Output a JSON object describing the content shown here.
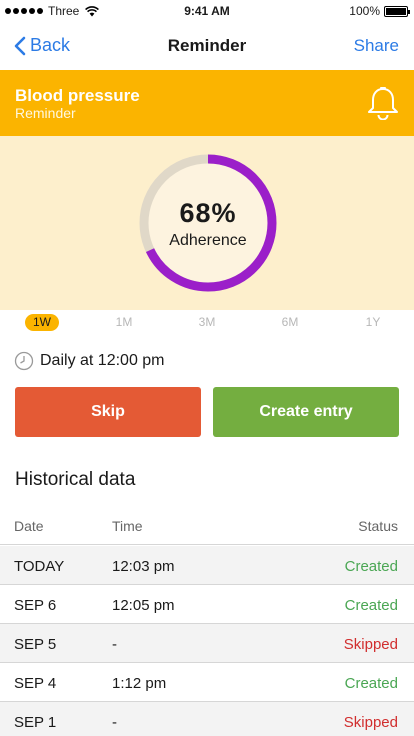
{
  "status_bar": {
    "carrier": "Three",
    "time": "9:41 AM",
    "battery": "100%"
  },
  "nav": {
    "back_label": "Back",
    "title": "Reminder",
    "share_label": "Share"
  },
  "header": {
    "title": "Blood pressure",
    "subtitle": "Reminder",
    "icon": "bell-icon",
    "color": "#fbb400"
  },
  "adherence": {
    "percent": "68%",
    "label": "Adherence",
    "fraction": 0.68,
    "ring_color": "#9b1fc9",
    "track_color": "#e0d8c8"
  },
  "range_tabs": [
    {
      "label": "1W",
      "active": true
    },
    {
      "label": "1M",
      "active": false
    },
    {
      "label": "3M",
      "active": false
    },
    {
      "label": "6M",
      "active": false
    },
    {
      "label": "1Y",
      "active": false
    }
  ],
  "schedule": {
    "text": "Daily at 12:00 pm",
    "icon": "clock-icon"
  },
  "actions": {
    "skip_label": "Skip",
    "create_label": "Create entry",
    "skip_color": "#e45a35",
    "create_color": "#74ae40"
  },
  "history": {
    "title": "Historical data",
    "columns": [
      "Date",
      "Time",
      "Status"
    ],
    "rows": [
      {
        "date": "TODAY",
        "time": "12:03 pm",
        "status": "Created"
      },
      {
        "date": "SEP 6",
        "time": "12:05 pm",
        "status": "Created"
      },
      {
        "date": "SEP 5",
        "time": "-",
        "status": "Skipped"
      },
      {
        "date": "SEP 4",
        "time": "1:12 pm",
        "status": "Created"
      },
      {
        "date": "SEP 1",
        "time": "-",
        "status": "Skipped"
      }
    ]
  }
}
